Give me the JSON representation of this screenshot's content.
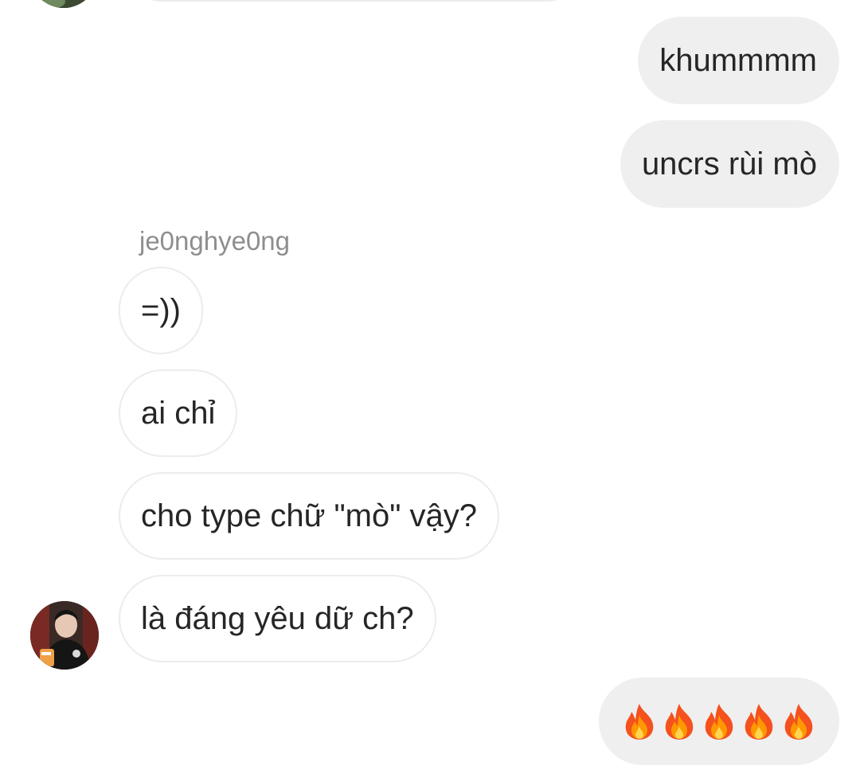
{
  "conversation": {
    "messages": [
      {
        "id": "m1",
        "side": "out",
        "text": "khummmm"
      },
      {
        "id": "m2",
        "side": "out",
        "text": "uncrs rùi mò"
      },
      {
        "id": "m3",
        "side": "in",
        "text": "=))"
      },
      {
        "id": "m4",
        "side": "in",
        "text": "ai chỉ"
      },
      {
        "id": "m5",
        "side": "in",
        "text": "cho type chữ \"mò\" vậy?"
      },
      {
        "id": "m6",
        "side": "in",
        "text": "là đáng yêu dữ ch?"
      },
      {
        "id": "m7",
        "side": "out",
        "emoji": [
          "fire-icon",
          "fire-icon",
          "fire-icon",
          "fire-icon",
          "fire-icon"
        ]
      }
    ],
    "sender_name": "je0nghye0ng"
  },
  "colors": {
    "outgoing_bubble": "#efefef",
    "incoming_border": "#ececec",
    "sender_name": "#8e8e8e",
    "text": "#262626"
  }
}
